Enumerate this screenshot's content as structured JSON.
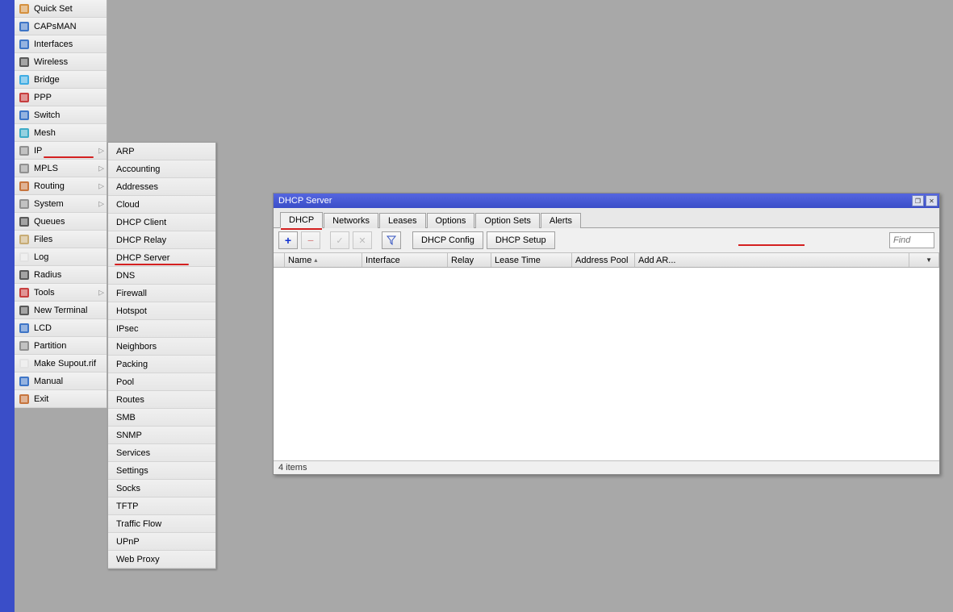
{
  "sidebar": {
    "items": [
      {
        "label": "Quick Set",
        "arrow": false,
        "icon": "quickset"
      },
      {
        "label": "CAPsMAN",
        "arrow": false,
        "icon": "capsman"
      },
      {
        "label": "Interfaces",
        "arrow": false,
        "icon": "interfaces"
      },
      {
        "label": "Wireless",
        "arrow": false,
        "icon": "wireless"
      },
      {
        "label": "Bridge",
        "arrow": false,
        "icon": "bridge"
      },
      {
        "label": "PPP",
        "arrow": false,
        "icon": "ppp"
      },
      {
        "label": "Switch",
        "arrow": false,
        "icon": "switch"
      },
      {
        "label": "Mesh",
        "arrow": false,
        "icon": "mesh"
      },
      {
        "label": "IP",
        "arrow": true,
        "icon": "ip",
        "highlighted": true
      },
      {
        "label": "MPLS",
        "arrow": true,
        "icon": "mpls"
      },
      {
        "label": "Routing",
        "arrow": true,
        "icon": "routing"
      },
      {
        "label": "System",
        "arrow": true,
        "icon": "system"
      },
      {
        "label": "Queues",
        "arrow": false,
        "icon": "queues"
      },
      {
        "label": "Files",
        "arrow": false,
        "icon": "files"
      },
      {
        "label": "Log",
        "arrow": false,
        "icon": "log"
      },
      {
        "label": "Radius",
        "arrow": false,
        "icon": "radius"
      },
      {
        "label": "Tools",
        "arrow": true,
        "icon": "tools"
      },
      {
        "label": "New Terminal",
        "arrow": false,
        "icon": "terminal"
      },
      {
        "label": "LCD",
        "arrow": false,
        "icon": "lcd"
      },
      {
        "label": "Partition",
        "arrow": false,
        "icon": "partition"
      },
      {
        "label": "Make Supout.rif",
        "arrow": false,
        "icon": "supout"
      },
      {
        "label": "Manual",
        "arrow": false,
        "icon": "manual"
      },
      {
        "label": "Exit",
        "arrow": false,
        "icon": "exit"
      }
    ]
  },
  "submenu": {
    "items": [
      "ARP",
      "Accounting",
      "Addresses",
      "Cloud",
      "DHCP Client",
      "DHCP Relay",
      "DHCP Server",
      "DNS",
      "Firewall",
      "Hotspot",
      "IPsec",
      "Neighbors",
      "Packing",
      "Pool",
      "Routes",
      "SMB",
      "SNMP",
      "Services",
      "Settings",
      "Socks",
      "TFTP",
      "Traffic Flow",
      "UPnP",
      "Web Proxy"
    ],
    "highlighted_index": 6
  },
  "window": {
    "title": "DHCP Server",
    "tabs": [
      "DHCP",
      "Networks",
      "Leases",
      "Options",
      "Option Sets",
      "Alerts"
    ],
    "active_tab": 0,
    "toolbar": {
      "add": "+",
      "remove": "−",
      "enable": "✓",
      "disable": "✕",
      "filter": "▼",
      "config_label": "DHCP Config",
      "setup_label": "DHCP Setup",
      "find_placeholder": "Find"
    },
    "columns": [
      "",
      "Name",
      "Interface",
      "Relay",
      "Lease Time",
      "Address Pool",
      "Add AR..."
    ],
    "status": "4 items"
  }
}
